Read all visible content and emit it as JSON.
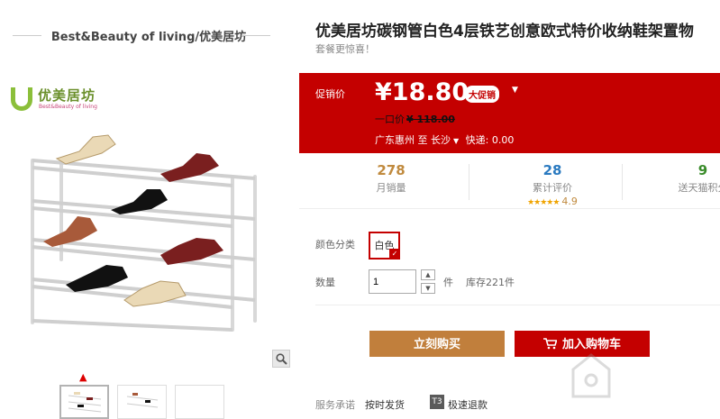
{
  "store": {
    "title": "Best&Beauty of living/优美居坊"
  },
  "logo": {
    "name": "优美居坊",
    "subtitle": "Best&Beauty of living"
  },
  "product": {
    "title": "优美居坊碳钢管白色4层铁艺创意欧式特价收纳鞋架置物",
    "subtitle": "套餐更惊喜！"
  },
  "price": {
    "label": "促销价",
    "current": "¥18.80",
    "badge": "大促销",
    "original_label": "一口价",
    "original_value": "¥ 118.00"
  },
  "shipping": {
    "from": "广东惠州",
    "to_word": "至",
    "to": "长沙",
    "express": "快递: 0.00"
  },
  "stats": [
    {
      "num": "278",
      "label": "月销量"
    },
    {
      "num": "28",
      "label": "累计评价",
      "stars": "★★★★★",
      "rating": "4.9"
    },
    {
      "num": "9",
      "label": "送天猫积分"
    }
  ],
  "options": {
    "color_label": "颜色分类",
    "color_value": "白色",
    "qty_label": "数量",
    "qty_value": "1",
    "qty_unit": "件",
    "stock": "库存221件"
  },
  "buttons": {
    "buy": "立刻购买",
    "cart": "加入购物车"
  },
  "service": {
    "label": "服务承诺",
    "item1": "按时发货",
    "t3": "T3",
    "item2": "极速退款"
  },
  "colors": {
    "accent": "#c40000",
    "buy": "#c17f3c",
    "logo_green": "#8bbf3a"
  },
  "icons": [
    "zoom-icon",
    "cart-icon",
    "caret-up-icon",
    "check-icon"
  ]
}
